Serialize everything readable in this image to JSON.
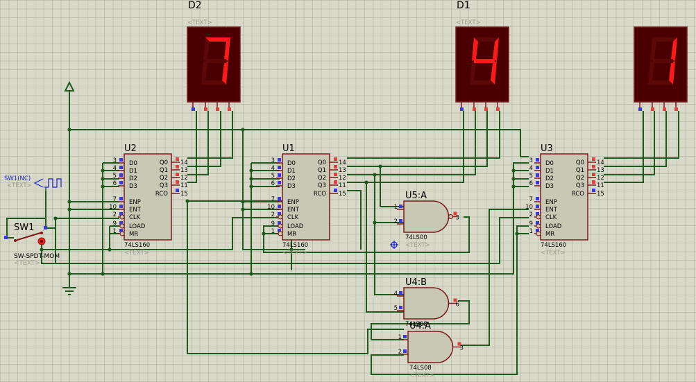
{
  "colors": {
    "wire": "#1e5a1e",
    "outline": "#7a1a1a",
    "chip_fill": "#c8c8b4",
    "display_bg": "#4a0000",
    "segment_on": "#ff1a1a",
    "segment_off": "#5a0808",
    "pin_red": "#e04040",
    "pin_blue": "#3a3ae0",
    "label": "#000000",
    "text_tag": "#9a9a90",
    "probe": "#1a1adf"
  },
  "displays": [
    {
      "ref": "D2",
      "tag": "<TEXT>",
      "digit": "7"
    },
    {
      "ref": "D1",
      "tag": "<TEXT>",
      "digit": "4"
    },
    {
      "ref": "",
      "tag": "",
      "digit": "1"
    }
  ],
  "counters": [
    {
      "ref": "U2",
      "part": "74LS160",
      "tag": "<TEXT>"
    },
    {
      "ref": "U1",
      "part": "74LS160",
      "tag": "<TEXT>"
    },
    {
      "ref": "U3",
      "part": "74LS160",
      "tag": "<TEXT>"
    }
  ],
  "counter_pins_left": [
    {
      "num": "3",
      "name": "D0"
    },
    {
      "num": "4",
      "name": "D1"
    },
    {
      "num": "5",
      "name": "D2"
    },
    {
      "num": "6",
      "name": "D3"
    },
    {
      "num": "7",
      "name": "ENP"
    },
    {
      "num": "10",
      "name": "ENT"
    },
    {
      "num": "2",
      "name": "CLK"
    },
    {
      "num": "9",
      "name": "LOAD"
    },
    {
      "num": "1",
      "name": "MR"
    }
  ],
  "counter_pins_right": [
    {
      "num": "14",
      "name": "Q0"
    },
    {
      "num": "13",
      "name": "Q1"
    },
    {
      "num": "12",
      "name": "Q2"
    },
    {
      "num": "11",
      "name": "Q3"
    },
    {
      "num": "15",
      "name": "RCO"
    }
  ],
  "gates": [
    {
      "ref": "U5:A",
      "part": "74LS00",
      "tag": "<TEXT>",
      "pins": [
        "1",
        "2",
        "3"
      ]
    },
    {
      "ref": "U4:B",
      "part": "74LS08",
      "tag": "",
      "pins": [
        "4",
        "5",
        "6"
      ]
    },
    {
      "ref": "U4:A",
      "part": "74LS08",
      "tag": "<TEXT>",
      "pins": [
        "1",
        "2",
        "3"
      ]
    }
  ],
  "switch": {
    "ref": "SW1",
    "part": "SW-SPDT-MOM",
    "tag": "<TEXT>"
  },
  "clock_source": {
    "label": "SW1(NC)",
    "tag": "<TEXT>"
  }
}
